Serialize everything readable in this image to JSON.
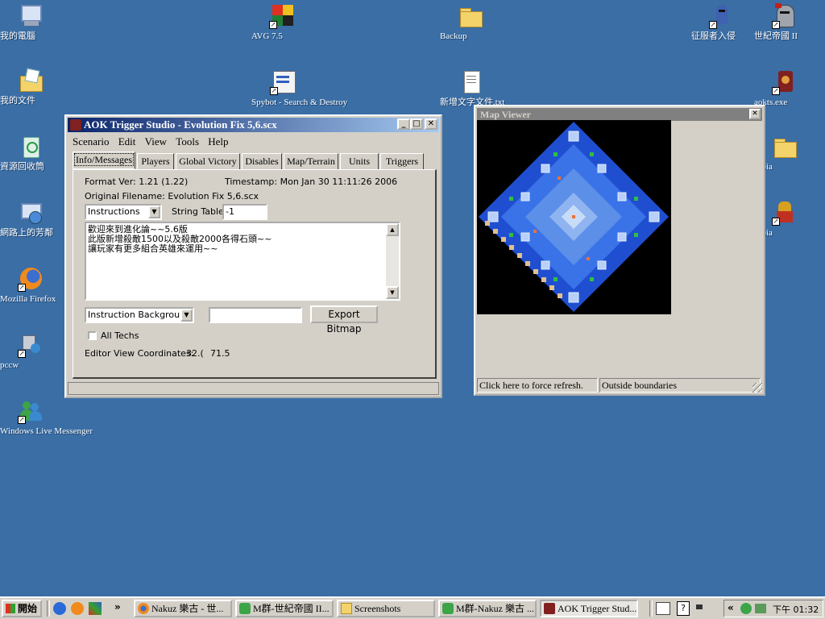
{
  "desktop": {
    "icons": [
      {
        "label": "我的電腦"
      },
      {
        "label": "我的文件"
      },
      {
        "label": "資源回收筒"
      },
      {
        "label": "網路上的芳鄰"
      },
      {
        "label": "Mozilla Firefox"
      },
      {
        "label": "pccw"
      },
      {
        "label": "Windows Live Messenger"
      },
      {
        "label": "AVG 7.5"
      },
      {
        "label": "Spybot - Search & Destroy"
      },
      {
        "label": "Backup"
      },
      {
        "label": "新增文字文件.txt"
      },
      {
        "label": "征服者入侵"
      },
      {
        "label": "世紀帝國 II"
      },
      {
        "label": "aokts.exe"
      },
      {
        "label": "Tibia"
      },
      {
        "label": "Tibia"
      }
    ]
  },
  "aok": {
    "title": "AOK Trigger Studio - Evolution Fix 5,6.scx",
    "menu": [
      "Scenario",
      "Edit",
      "View",
      "Tools",
      "Help"
    ],
    "tabs": [
      "Info/Messages",
      "Players",
      "Global Victory",
      "Disables",
      "Map/Terrain",
      "Units",
      "Triggers"
    ],
    "format_ver": "Format Ver: 1.21 (1.22)",
    "timestamp": "Timestamp: Mon Jan 30 11:11:26 2006",
    "orig_filename": "Original Filename:  Evolution Fix 5,6.scx",
    "message_select": "Instructions",
    "string_table_label": "String Table:",
    "string_table_value": "-1",
    "message_lines": [
      "歡迎來到進化論~~5.6版",
      "此版新增殺敵1500以及殺敵2000各得石頭~~",
      "讓玩家有更多組合英雄來運用~~"
    ],
    "bg_select": "Instruction Background",
    "bitmap_input": "",
    "export_button": "Export Bitmap",
    "all_techs": "All Techs",
    "coords_label": "Editor View Coordinates:",
    "coord_x": "32.(",
    "coord_y": "71.5"
  },
  "mapviewer": {
    "title": "Map Viewer",
    "status_left": "Click here to force refresh.",
    "status_right": "Outside boundaries"
  },
  "taskbar": {
    "start": "開始",
    "tasks": [
      "Nakuz 樂古 - 世...",
      "M群-世紀帝國 II...",
      "Screenshots",
      "M群-Nakuz 樂古 ...",
      "AOK Trigger Stud..."
    ],
    "tray_time": "下午 01:32",
    "chevron": "«",
    "ql_chevron": "»"
  },
  "colors": {
    "desktop": "#3a6ea5",
    "title_active_start": "#0a246a",
    "title_active_end": "#a6caf0",
    "title_inactive": "#808080"
  }
}
